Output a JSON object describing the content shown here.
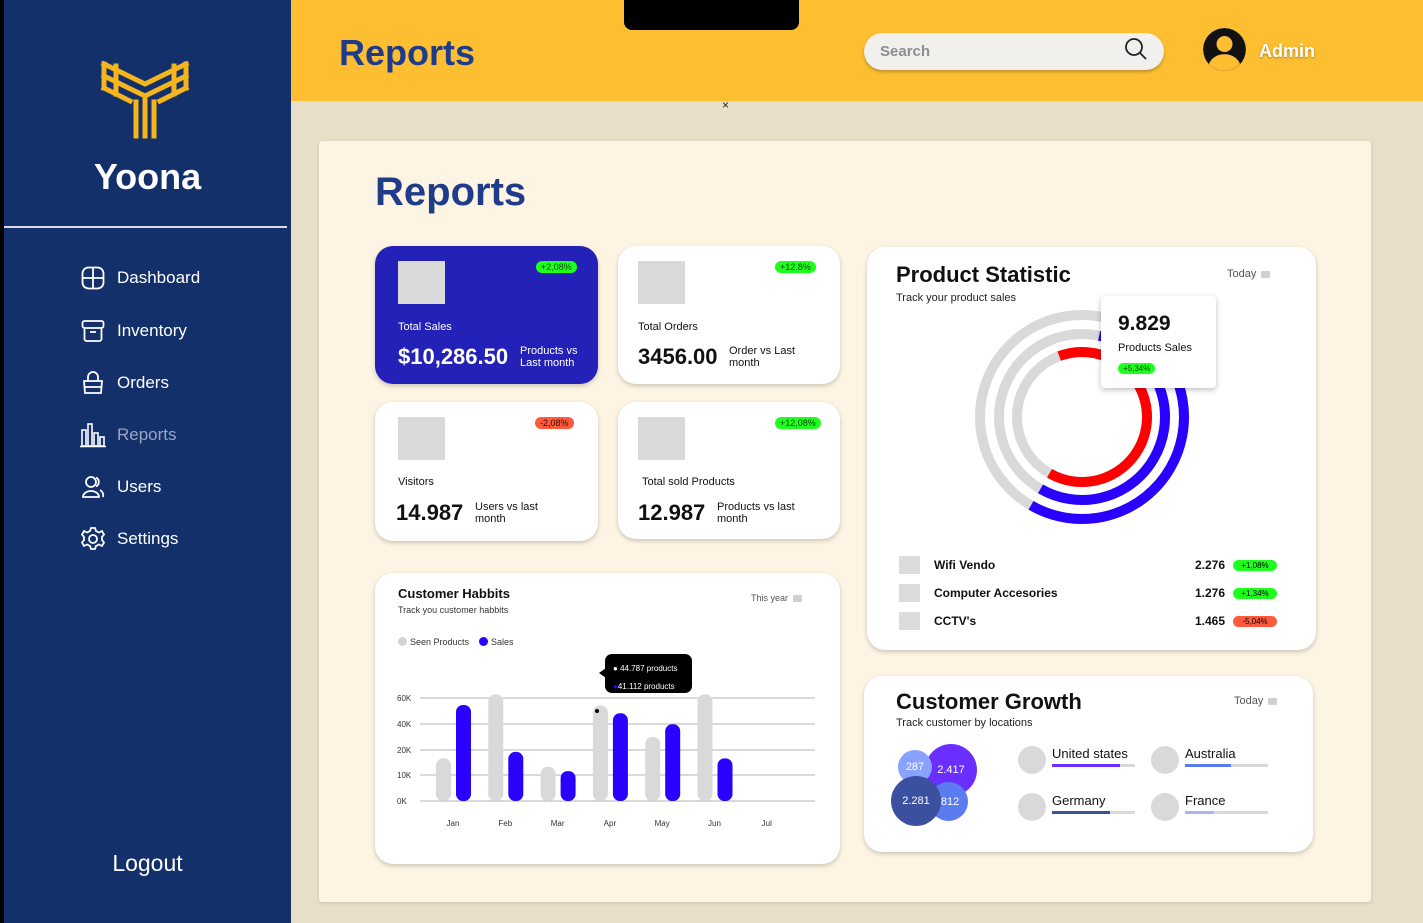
{
  "sidebar": {
    "brand": "Yoona",
    "items": [
      {
        "label": "Dashboard",
        "icon": "grid-icon"
      },
      {
        "label": "Inventory",
        "icon": "archive-icon"
      },
      {
        "label": "Orders",
        "icon": "shopping-bag-icon"
      },
      {
        "label": "Reports",
        "icon": "bar-chart-icon",
        "active": true
      },
      {
        "label": "Users",
        "icon": "users-icon"
      },
      {
        "label": "Settings",
        "icon": "gear-icon"
      }
    ],
    "logout": "Logout"
  },
  "topbar": {
    "title": "Reports",
    "search_placeholder": "Search",
    "user": "Admin"
  },
  "close_glyph": "×",
  "page_title": "Reports",
  "kpis": [
    {
      "label": "Total Sales",
      "value": "$10,286.50",
      "note": "Products vs Last month",
      "badge": "+2,08%",
      "trend": "up"
    },
    {
      "label": "Total Orders",
      "value": "3456.00",
      "note": "Order vs Last month",
      "badge": "+12.8%",
      "trend": "up"
    },
    {
      "label": "Visitors",
      "value": "14.987",
      "note": "Users vs last month",
      "badge": "-2,08%",
      "trend": "down"
    },
    {
      "label": "Total sold Products",
      "value": "12.987",
      "note": "Products vs last month",
      "badge": "+12,08%",
      "trend": "up"
    }
  ],
  "product_statistic": {
    "title": "Product Statistic",
    "subtitle": "Track your product sales",
    "period": "Today",
    "total": "9.829",
    "total_label": "Products Sales",
    "total_badge": "+5,34%",
    "rows": [
      {
        "name": "Wifi Vendo",
        "value": "2.276",
        "badge": "+1,08%",
        "trend": "up"
      },
      {
        "name": "Computer Accesories",
        "value": "1.276",
        "badge": "+1,34%",
        "trend": "up"
      },
      {
        "name": "CCTV's",
        "value": "1.465",
        "badge": "-5,04%",
        "trend": "down"
      }
    ],
    "rings": [
      {
        "fraction": 0.47,
        "color": "#2a00ff"
      },
      {
        "fraction": 0.55,
        "color": "#2a00ff"
      },
      {
        "fraction": 0.64,
        "color": "#ff0000"
      }
    ]
  },
  "customer_growth": {
    "title": "Customer Growth",
    "subtitle": "Track customer by locations",
    "period": "Today",
    "bubbles": [
      "287",
      "2.417",
      "2.281",
      ".812"
    ],
    "countries": [
      {
        "name": "United states",
        "fraction": 0.82,
        "color": "#6a2fff"
      },
      {
        "name": "Australia",
        "fraction": 0.55,
        "color": "#5b7bf0"
      },
      {
        "name": "Germany",
        "fraction": 0.7,
        "color": "#3b51a0"
      },
      {
        "name": "France",
        "fraction": 0.35,
        "color": "#a9b6f3"
      }
    ]
  },
  "customer_habits": {
    "title": "Customer Habbits",
    "subtitle": "Track you customer habbits",
    "period": "This year",
    "legend_seen": "Seen Products",
    "legend_sales": "Sales",
    "tooltip_seen": "44.787 products",
    "tooltip_sales": "41.112 products"
  },
  "colors": {
    "navy": "#13306a",
    "yellow": "#fdbf31",
    "blue": "#2a00ff",
    "accent_title": "#1e3c8a"
  },
  "chart_data": {
    "type": "bar",
    "title": "Customer Habbits",
    "categories": [
      "Jan",
      "Feb",
      "Mar",
      "Apr",
      "May",
      "Jun",
      "Jul"
    ],
    "yticks": [
      "60K",
      "40K",
      "20K",
      "10K",
      "0K"
    ],
    "ylim": [
      0,
      60000
    ],
    "series": [
      {
        "name": "Seen Products",
        "color": "#d9d9d9",
        "values": [
          20000,
          50000,
          16000,
          44787,
          30000,
          50000,
          null
        ]
      },
      {
        "name": "Sales",
        "color": "#2a00ff",
        "values": [
          45000,
          23000,
          14000,
          41112,
          36000,
          20000,
          null
        ]
      }
    ],
    "grid": true,
    "legend": "top-left"
  }
}
